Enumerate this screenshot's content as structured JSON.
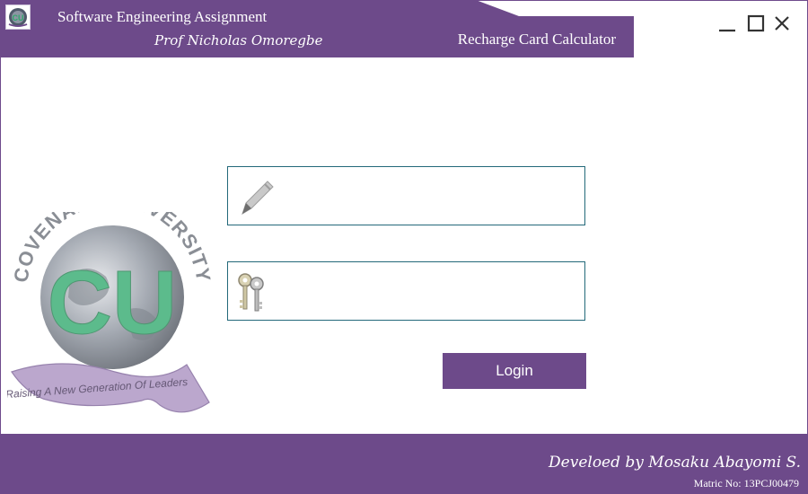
{
  "header": {
    "title": "Software Engineering Assignment",
    "subtitle": "Prof Nicholas Omoregbe",
    "app_name": "Recharge Card Calculator"
  },
  "window_controls": {
    "minimize": "minimize",
    "maximize": "maximize",
    "close": "close"
  },
  "emblem": {
    "arc_text": "COVENANT UNIVERSITY",
    "monogram": "CU",
    "ribbon_text": "Raising A New Generation Of Leaders"
  },
  "form": {
    "username_value": "",
    "password_value": "",
    "login_label": "Login"
  },
  "footer": {
    "developer": "Develoed by Mosaku Abayomi S.",
    "matric": "Matric No: 13PCJ00479"
  },
  "colors": {
    "brand_purple": "#6d4a8a",
    "field_border": "#23697a",
    "monogram_green": "#2fa86c"
  },
  "icons": {
    "username": "pencil-icon",
    "password": "keys-icon"
  }
}
